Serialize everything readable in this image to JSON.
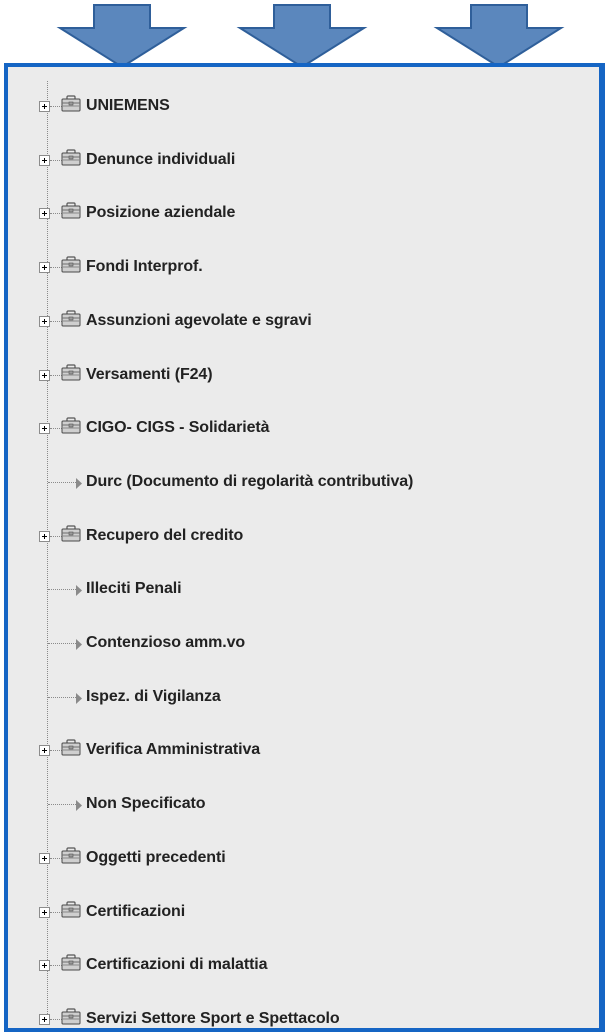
{
  "tree": {
    "items": [
      {
        "label": "UNIEMENS",
        "type": "folder"
      },
      {
        "label": "Denunce individuali",
        "type": "folder"
      },
      {
        "label": "Posizione aziendale",
        "type": "folder"
      },
      {
        "label": "Fondi Interprof.",
        "type": "folder"
      },
      {
        "label": "Assunzioni agevolate e sgravi",
        "type": "folder"
      },
      {
        "label": "Versamenti (F24)",
        "type": "folder"
      },
      {
        "label": "CIGO- CIGS - Solidarietà",
        "type": "folder"
      },
      {
        "label": "Durc (Documento di regolarità contributiva)",
        "type": "leaf"
      },
      {
        "label": "Recupero del credito",
        "type": "folder"
      },
      {
        "label": "Illeciti Penali",
        "type": "leaf"
      },
      {
        "label": "Contenzioso amm.vo",
        "type": "leaf"
      },
      {
        "label": "Ispez. di Vigilanza",
        "type": "leaf"
      },
      {
        "label": "Verifica Amministrativa",
        "type": "folder"
      },
      {
        "label": "Non Specificato",
        "type": "leaf"
      },
      {
        "label": "Oggetti precedenti",
        "type": "folder"
      },
      {
        "label": "Certificazioni",
        "type": "folder"
      },
      {
        "label": "Certificazioni di malattia",
        "type": "folder"
      },
      {
        "label": "Servizi Settore Sport e Spettacolo",
        "type": "folder"
      }
    ]
  },
  "icons": {
    "expand": "plus-box-icon",
    "folder": "briefcase-icon",
    "leaf": "triangle-bullet-icon",
    "pointer": "down-arrow-icon"
  },
  "colors": {
    "frame": "#1565c4",
    "arrow_fill": "#5b87bd",
    "arrow_stroke": "#2f5f9a",
    "panel_bg": "#ebebeb",
    "text": "#222222"
  }
}
